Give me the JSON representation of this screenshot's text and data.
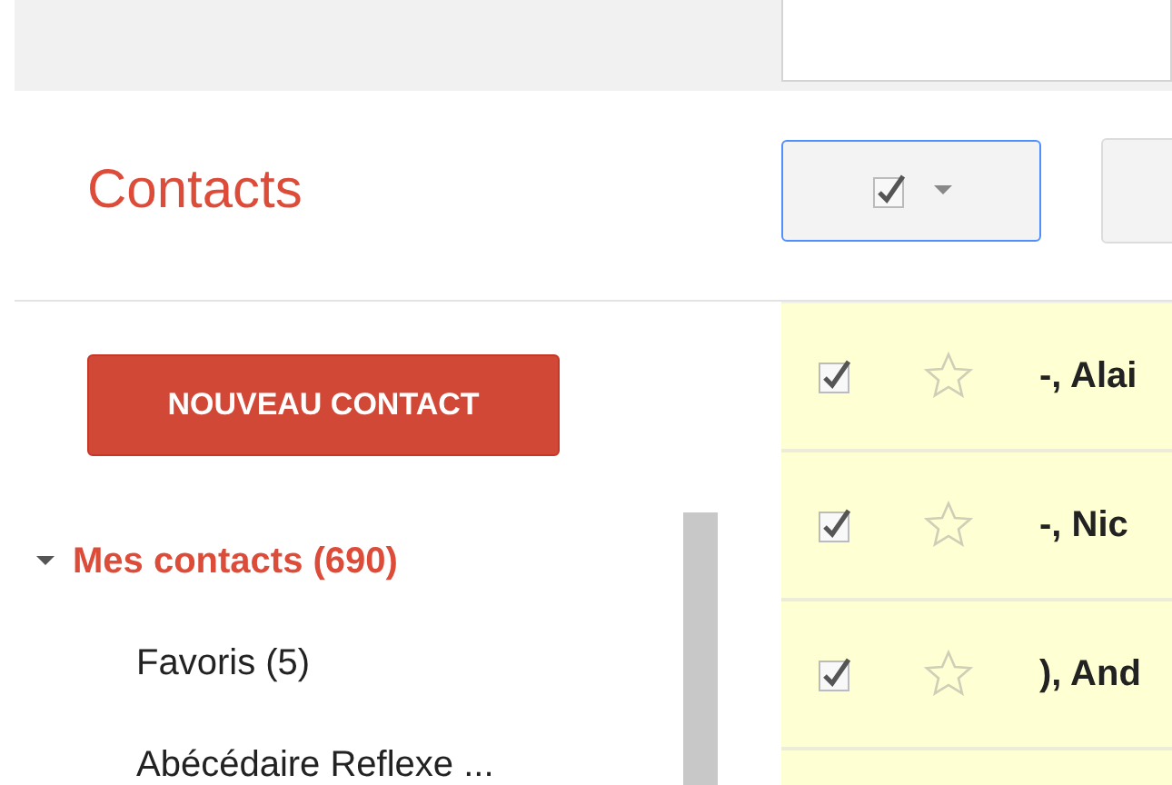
{
  "title": "Contacts",
  "toolbar": {
    "select_all": {
      "checked": true
    }
  },
  "new_contact_button": "NOUVEAU CONTACT",
  "sidebar": {
    "items": [
      {
        "label": "Mes contacts (690)",
        "selected": true,
        "expanded": true,
        "children": [
          {
            "label": "Favoris (5)",
            "selected": false
          },
          {
            "label": "Abécédaire Reflexe ...",
            "selected": false
          }
        ]
      }
    ]
  },
  "contacts": [
    {
      "name": "-, Alai",
      "checked": true,
      "starred": false
    },
    {
      "name": "-, Nic",
      "checked": true,
      "starred": false
    },
    {
      "name": "), And",
      "checked": true,
      "starred": false
    }
  ]
}
